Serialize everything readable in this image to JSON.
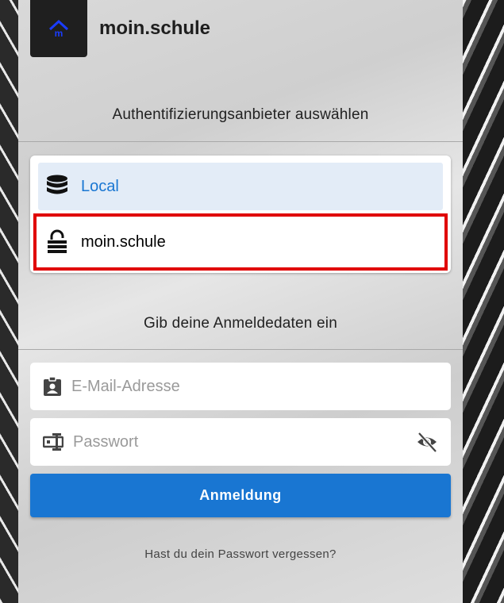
{
  "app": {
    "title": "moin.schule",
    "logo_text": "m"
  },
  "providers": {
    "heading": "Authentifizierungsanbieter auswählen",
    "items": [
      {
        "label": "Local",
        "icon": "database-icon",
        "selected": true
      },
      {
        "label": "moin.schule",
        "icon": "lock-icon",
        "selected": false,
        "highlighted": true
      }
    ]
  },
  "credentials": {
    "heading": "Gib deine Anmeldedaten ein",
    "email": {
      "placeholder": "E-Mail-Adresse",
      "value": ""
    },
    "password": {
      "placeholder": "Passwort",
      "value": ""
    }
  },
  "login_button": {
    "label": "Anmeldung"
  },
  "forgot_link": {
    "label": "Hast du dein Passwort vergessen?"
  },
  "colors": {
    "accent": "#1976d2",
    "highlight": "#e00000",
    "selected_bg": "#e3ecf7"
  }
}
